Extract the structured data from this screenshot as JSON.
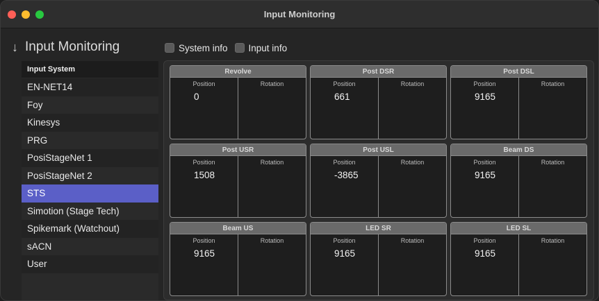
{
  "window": {
    "title": "Input Monitoring"
  },
  "sidebar": {
    "header": "Input Monitoring",
    "list_header": "Input System",
    "items": [
      {
        "label": "EN-NET14",
        "selected": false
      },
      {
        "label": "Foy",
        "selected": false
      },
      {
        "label": "Kinesys",
        "selected": false
      },
      {
        "label": "PRG",
        "selected": false
      },
      {
        "label": "PosiStageNet 1",
        "selected": false
      },
      {
        "label": "PosiStageNet 2",
        "selected": false
      },
      {
        "label": "STS",
        "selected": true
      },
      {
        "label": "Simotion (Stage Tech)",
        "selected": false
      },
      {
        "label": "Spikemark (Watchout)",
        "selected": false
      },
      {
        "label": "sACN",
        "selected": false
      },
      {
        "label": "User",
        "selected": false
      }
    ]
  },
  "options": {
    "system_info": {
      "label": "System info",
      "checked": false
    },
    "input_info": {
      "label": "Input info",
      "checked": false
    }
  },
  "labels": {
    "position": "Position",
    "rotation": "Rotation"
  },
  "cards": [
    {
      "name": "Revolve",
      "position": "0",
      "rotation": ""
    },
    {
      "name": "Post DSR",
      "position": "661",
      "rotation": ""
    },
    {
      "name": "Post DSL",
      "position": "9165",
      "rotation": ""
    },
    {
      "name": "Post USR",
      "position": "1508",
      "rotation": ""
    },
    {
      "name": "Post USL",
      "position": "-3865",
      "rotation": ""
    },
    {
      "name": "Beam DS",
      "position": "9165",
      "rotation": ""
    },
    {
      "name": "Beam US",
      "position": "9165",
      "rotation": ""
    },
    {
      "name": "LED SR",
      "position": "9165",
      "rotation": ""
    },
    {
      "name": "LED SL",
      "position": "9165",
      "rotation": ""
    }
  ],
  "colors": {
    "accent": "#5b5fc7",
    "close": "#ff5f57",
    "minimize": "#febc2e",
    "maximize": "#28c840"
  }
}
